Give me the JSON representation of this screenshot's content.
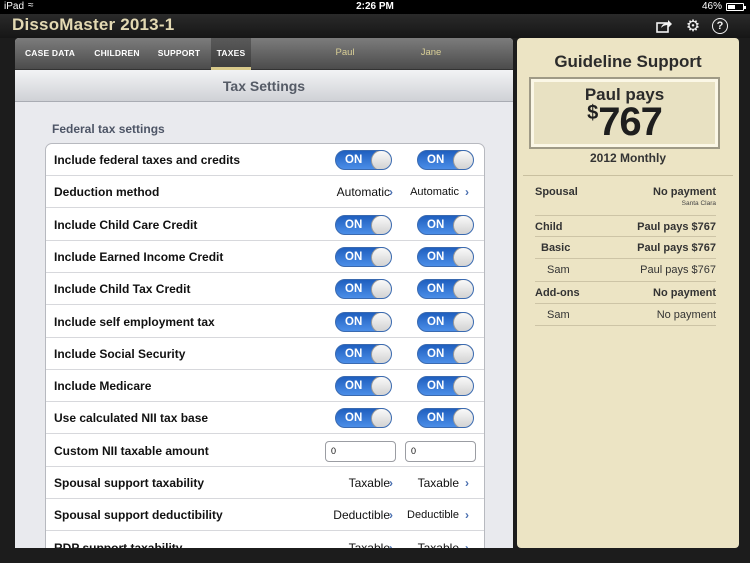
{
  "status_bar": {
    "carrier": "iPad",
    "time": "2:26 PM",
    "battery": "46%",
    "battery_level": 0.46
  },
  "app": {
    "title": "DissoMaster 2013-1",
    "icons": [
      "share-icon",
      "gear-icon",
      "help-icon"
    ]
  },
  "tabs": [
    {
      "label": "CASE DATA",
      "active": false
    },
    {
      "label": "CHILDREN",
      "active": false
    },
    {
      "label": "SUPPORT",
      "active": false
    },
    {
      "label": "TAXES",
      "active": true
    }
  ],
  "columns": [
    "Paul",
    "Jane"
  ],
  "page_title": "Tax Settings",
  "section_label": "Federal tax settings",
  "rows": [
    {
      "label": "Include federal taxes and credits",
      "type": "toggle",
      "values": [
        "ON",
        "ON"
      ]
    },
    {
      "label": "Deduction method",
      "type": "select",
      "values": [
        "Automatic",
        "Automatic"
      ]
    },
    {
      "label": "Include Child Care Credit",
      "type": "toggle",
      "values": [
        "ON",
        "ON"
      ]
    },
    {
      "label": "Include Earned Income Credit",
      "type": "toggle",
      "values": [
        "ON",
        "ON"
      ]
    },
    {
      "label": "Include Child Tax Credit",
      "type": "toggle",
      "values": [
        "ON",
        "ON"
      ]
    },
    {
      "label": "Include self employment tax",
      "type": "toggle",
      "values": [
        "ON",
        "ON"
      ]
    },
    {
      "label": "Include Social Security",
      "type": "toggle",
      "values": [
        "ON",
        "ON"
      ]
    },
    {
      "label": "Include Medicare",
      "type": "toggle",
      "values": [
        "ON",
        "ON"
      ]
    },
    {
      "label": "Use calculated NII tax base",
      "type": "toggle",
      "values": [
        "ON",
        "ON"
      ]
    },
    {
      "label": "Custom NII taxable amount",
      "type": "input",
      "values": [
        "0",
        "0"
      ]
    },
    {
      "label": "Spousal support taxability",
      "type": "select",
      "values": [
        "Taxable",
        "Taxable"
      ]
    },
    {
      "label": "Spousal support deductibility",
      "type": "select",
      "values": [
        "Deductible",
        "Deductible"
      ]
    },
    {
      "label": "RDP support taxability",
      "type": "select",
      "values": [
        "Taxable",
        "Taxable"
      ]
    }
  ],
  "guideline": {
    "title": "Guideline Support",
    "payer": "Paul pays",
    "currency": "$",
    "amount": "767",
    "period": "2012 Monthly",
    "summary": [
      {
        "key": "Spousal",
        "value": "No payment",
        "note": "Santa Clara",
        "level": 0
      },
      {
        "key": "Child",
        "value": "Paul pays $767",
        "level": 0
      },
      {
        "key": "Basic",
        "value": "Paul pays $767",
        "level": 1
      },
      {
        "key": "Sam",
        "value": "Paul pays $767",
        "level": 2
      },
      {
        "key": "Add-ons",
        "value": "No payment",
        "level": 0
      },
      {
        "key": "Sam",
        "value": "No payment",
        "level": 2
      }
    ]
  }
}
